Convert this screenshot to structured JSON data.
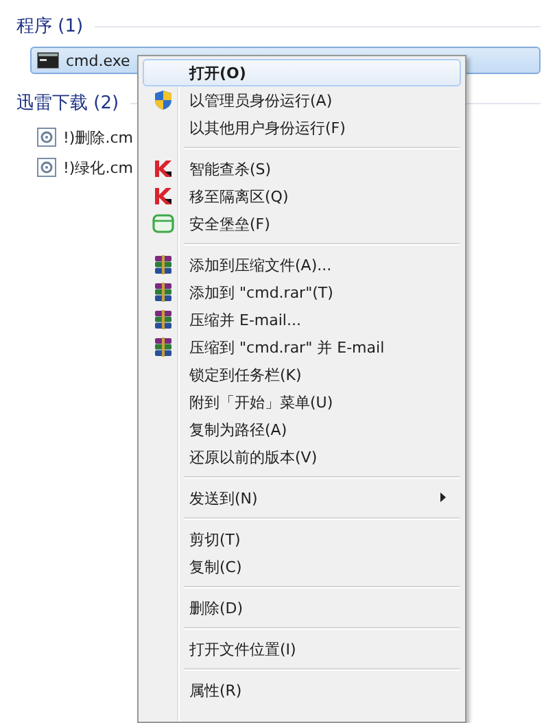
{
  "groups": [
    {
      "header": "程序 (1)",
      "items": [
        {
          "label": "cmd.exe",
          "kind": "console",
          "selected": true
        }
      ]
    },
    {
      "header": "迅雷下载 (2)",
      "items": [
        {
          "label": "!)删除.cm",
          "kind": "script",
          "selected": false
        },
        {
          "label": "!)绿化.cm",
          "kind": "script",
          "selected": false
        }
      ]
    }
  ],
  "context_menu": [
    {
      "kind": "plain",
      "label": "打开(O)",
      "bold": true,
      "selected": true
    },
    {
      "kind": "shield",
      "label": "以管理员身份运行(A)",
      "selected": false
    },
    {
      "kind": "plain",
      "label": "以其他用户身份运行(F)",
      "selected": false
    },
    {
      "kind": "separator"
    },
    {
      "kind": "antivirus",
      "label": "智能查杀(S)",
      "selected": false
    },
    {
      "kind": "antivirus",
      "label": "移至隔离区(Q)",
      "selected": false
    },
    {
      "kind": "sandbox",
      "label": "安全堡垒(F)",
      "selected": false
    },
    {
      "kind": "separator"
    },
    {
      "kind": "archive",
      "label": "添加到压缩文件(A)...",
      "selected": false
    },
    {
      "kind": "archive",
      "label": "添加到 \"cmd.rar\"(T)",
      "selected": false
    },
    {
      "kind": "archive",
      "label": "压缩并 E-mail...",
      "selected": false
    },
    {
      "kind": "archive",
      "label": "压缩到 \"cmd.rar\" 并 E-mail",
      "selected": false
    },
    {
      "kind": "plain",
      "label": "锁定到任务栏(K)",
      "selected": false
    },
    {
      "kind": "plain",
      "label": "附到「开始」菜单(U)",
      "selected": false
    },
    {
      "kind": "plain",
      "label": "复制为路径(A)",
      "selected": false
    },
    {
      "kind": "plain",
      "label": "还原以前的版本(V)",
      "selected": false
    },
    {
      "kind": "separator"
    },
    {
      "kind": "plain",
      "label": "发送到(N)",
      "submenu": true,
      "selected": false
    },
    {
      "kind": "separator"
    },
    {
      "kind": "plain",
      "label": "剪切(T)",
      "selected": false
    },
    {
      "kind": "plain",
      "label": "复制(C)",
      "selected": false
    },
    {
      "kind": "separator"
    },
    {
      "kind": "plain",
      "label": "删除(D)",
      "selected": false
    },
    {
      "kind": "separator"
    },
    {
      "kind": "plain",
      "label": "打开文件位置(I)",
      "selected": false
    },
    {
      "kind": "separator"
    },
    {
      "kind": "plain",
      "label": "属性(R)",
      "selected": false
    }
  ]
}
